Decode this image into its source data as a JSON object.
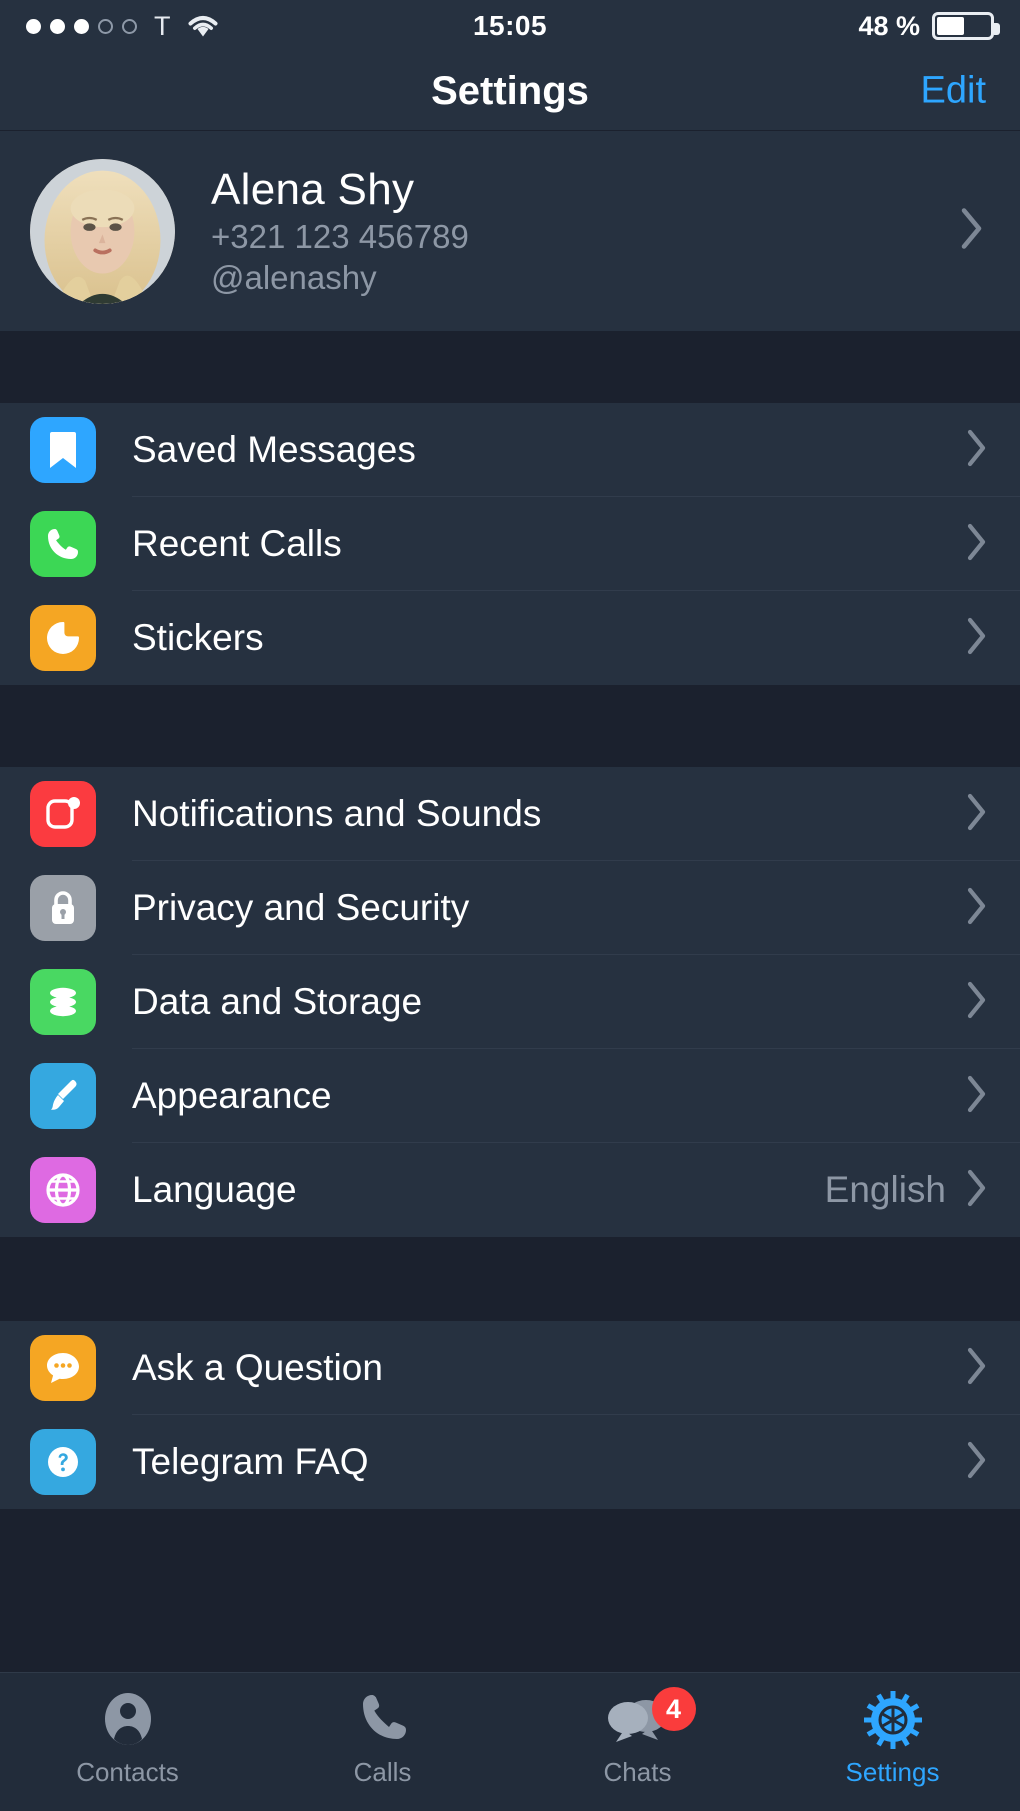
{
  "status_bar": {
    "signal_filled": 3,
    "signal_empty": 2,
    "carrier": "T",
    "wifi_icon": "wifi-icon",
    "time": "15:05",
    "battery_percent": "48 %",
    "battery_level": 48
  },
  "nav": {
    "title": "Settings",
    "edit_label": "Edit"
  },
  "profile": {
    "name": "Alena Shy",
    "phone": "+321 123 456789",
    "username": "@alenashy",
    "avatar_alt": "avatar"
  },
  "sections": [
    {
      "rows": [
        {
          "label": "Saved Messages",
          "icon": "bookmark-icon",
          "color": "#2ea6ff",
          "value": ""
        },
        {
          "label": "Recent Calls",
          "icon": "phone-icon",
          "color": "#3cd755",
          "value": ""
        },
        {
          "label": "Stickers",
          "icon": "sticker-icon",
          "color": "#f5a623",
          "value": ""
        }
      ]
    },
    {
      "rows": [
        {
          "label": "Notifications and Sounds",
          "icon": "notification-icon",
          "color": "#fb3b40",
          "value": ""
        },
        {
          "label": "Privacy and Security",
          "icon": "lock-icon",
          "color": "#9aa0a8",
          "value": ""
        },
        {
          "label": "Data and Storage",
          "icon": "database-icon",
          "color": "#49d862",
          "value": ""
        },
        {
          "label": "Appearance",
          "icon": "paintbrush-icon",
          "color": "#35a8e0",
          "value": ""
        },
        {
          "label": "Language",
          "icon": "globe-icon",
          "color": "#de6ae2",
          "value": "English"
        }
      ]
    },
    {
      "rows": [
        {
          "label": "Ask a Question",
          "icon": "chat-question-icon",
          "color": "#f5a623",
          "value": ""
        },
        {
          "label": "Telegram FAQ",
          "icon": "help-circle-icon",
          "color": "#35a8e0",
          "value": ""
        }
      ]
    }
  ],
  "tabs": [
    {
      "label": "Contacts",
      "icon": "contacts-icon",
      "active": false,
      "badge": ""
    },
    {
      "label": "Calls",
      "icon": "calls-icon",
      "active": false,
      "badge": ""
    },
    {
      "label": "Chats",
      "icon": "chats-icon",
      "active": false,
      "badge": "4"
    },
    {
      "label": "Settings",
      "icon": "settings-gear-icon",
      "active": true,
      "badge": ""
    }
  ],
  "colors": {
    "accent": "#2ea6ff",
    "row_bg": "#263140",
    "page_bg": "#1b212e",
    "badge": "#fa3c3c",
    "secondary_text": "#8d97a5"
  }
}
